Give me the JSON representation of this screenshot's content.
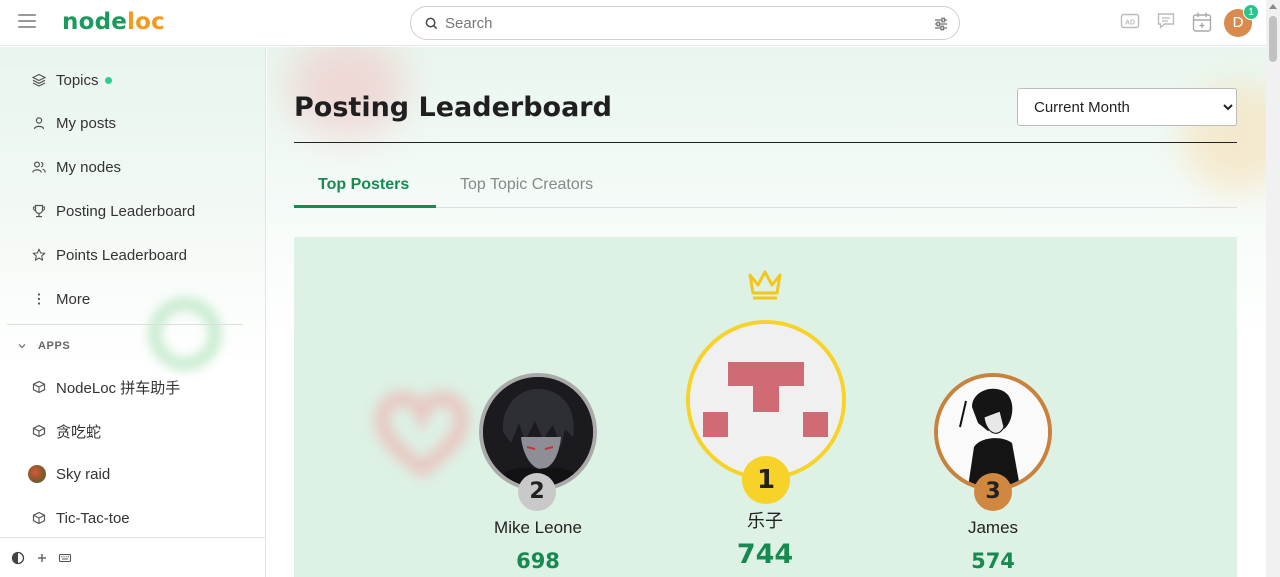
{
  "header": {
    "logo_part1": "node",
    "logo_part2": "loc",
    "search_placeholder": "Search",
    "avatar_initial": "D",
    "notification_count": "1",
    "icons": [
      "ad-icon",
      "chat-icon",
      "calendar-icon"
    ]
  },
  "sidebar": {
    "items": [
      {
        "label": "Topics",
        "icon": "layers-icon"
      },
      {
        "label": "My posts",
        "icon": "user-icon"
      },
      {
        "label": "My nodes",
        "icon": "users-icon"
      },
      {
        "label": "Posting Leaderboard",
        "icon": "trophy-icon"
      },
      {
        "label": "Points Leaderboard",
        "icon": "star-icon"
      },
      {
        "label": "More",
        "icon": "more-vertical-icon"
      }
    ],
    "apps_heading": "APPS",
    "apps": [
      {
        "label": "NodeLoc 拼车助手",
        "icon": "cube-icon"
      },
      {
        "label": "贪吃蛇",
        "icon": "cube-icon"
      },
      {
        "label": "Sky raid",
        "icon": "sky-raid-image"
      },
      {
        "label": "Tic-Tac-toe",
        "icon": "cube-icon"
      }
    ]
  },
  "main": {
    "title": "Posting Leaderboard",
    "period": {
      "selected": "Current Month"
    },
    "tabs": [
      {
        "label": "Top Posters",
        "active": true
      },
      {
        "label": "Top Topic Creators",
        "active": false
      }
    ],
    "podium": [
      {
        "rank": "2",
        "name": "Mike Leone",
        "count": "698"
      },
      {
        "rank": "1",
        "name": "乐子",
        "count": "744"
      },
      {
        "rank": "3",
        "name": "James",
        "count": "574"
      }
    ]
  },
  "colors": {
    "accent": "#178a52",
    "gold": "#f7d32a",
    "silver": "#c9c9c9",
    "bronze": "#d08841"
  }
}
